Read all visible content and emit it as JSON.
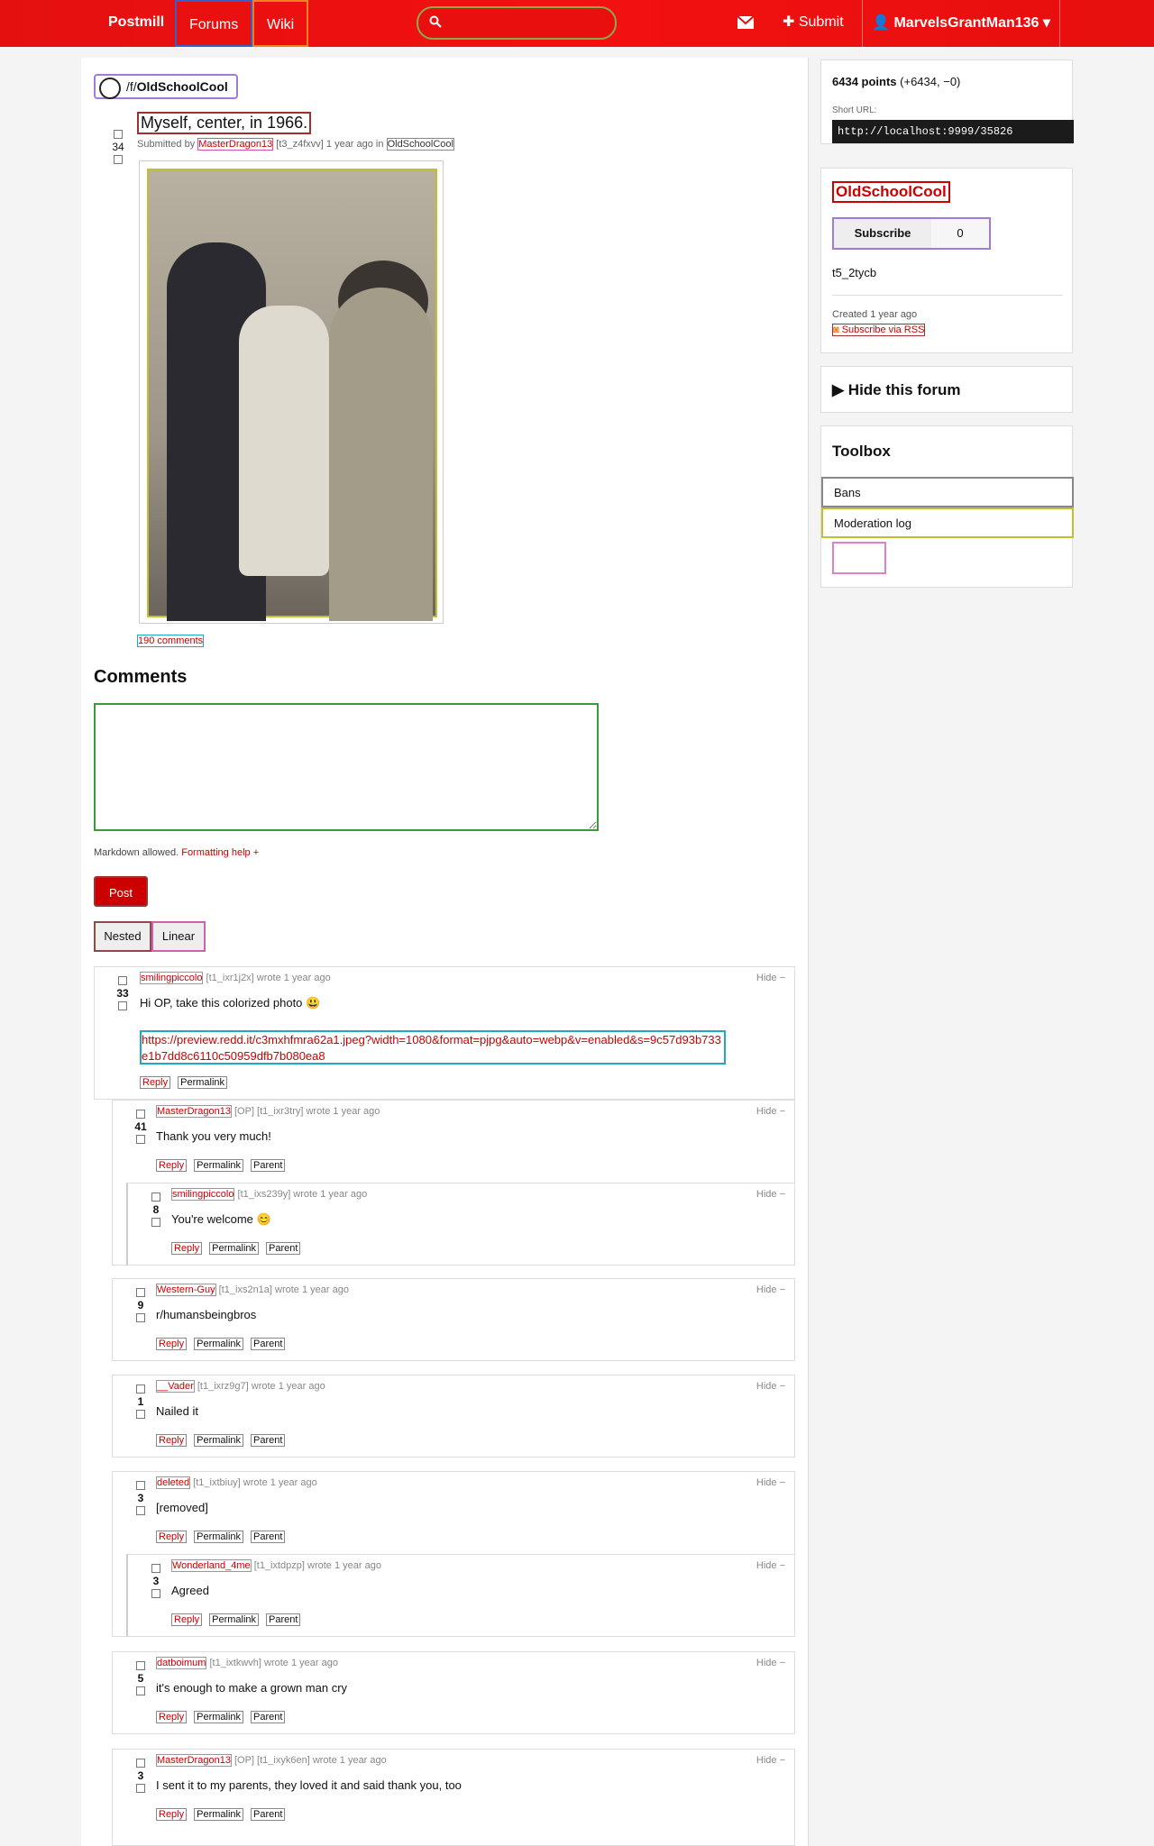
{
  "header": {
    "brand": "Postmill",
    "nav": {
      "forums": "Forums",
      "wiki": "Wiki"
    },
    "search_placeholder": "",
    "submit": "Submit",
    "user": "MarvelsGrantMan136 ▾"
  },
  "post": {
    "back_prefix": "/f/",
    "forum": "OldSchoolCool",
    "title": "Myself, center, in 1966.",
    "meta_prefix": "Submitted by",
    "author": "MasterDragon13",
    "meta_mid": "[t3_z4fxvv] 1 year ago in",
    "forum_link": "OldSchoolCool",
    "score": "34",
    "comments_link": "190 comments"
  },
  "comment_form": {
    "heading": "Comments",
    "markdown_note": "Markdown allowed.",
    "formatting_help": "Formatting help +",
    "post_label": "Post",
    "nested_label": "Nested",
    "linear_label": "Linear"
  },
  "comments": [
    {
      "user": "smilingpiccolo",
      "id": "[t1_ixr1j2x] wrote 1 year ago",
      "score": "33",
      "body": "Hi OP, take this colorized photo 😃",
      "link": "https://preview.redd.it/c3mxhfmra62a1.jpeg?width=1080&format=pjpg&auto=webp&v=enabled&s=9c57d93b733e1b7dd8c6110c50959dfb7b080ea8",
      "actions": [
        "Reply",
        "Permalink"
      ]
    },
    {
      "user": "MasterDragon13",
      "id": "[OP] [t1_ixr3try] wrote 1 year ago",
      "score": "41",
      "body": "Thank you very much!",
      "actions": [
        "Reply",
        "Permalink",
        "Parent"
      ]
    },
    {
      "user": "smilingpiccolo",
      "id": "[t1_ixs239y] wrote 1 year ago",
      "score": "8",
      "body": "You're welcome 😊",
      "actions": [
        "Reply",
        "Permalink",
        "Parent"
      ]
    },
    {
      "user": "Western-Guy",
      "id": "[t1_ixs2n1a] wrote 1 year ago",
      "score": "9",
      "body": "r/humansbeingbros",
      "actions": [
        "Reply",
        "Permalink",
        "Parent"
      ]
    },
    {
      "user": "__Vader",
      "id": "[t1_ixrz9g7] wrote 1 year ago",
      "score": "1",
      "body": "Nailed it",
      "actions": [
        "Reply",
        "Permalink",
        "Parent"
      ]
    },
    {
      "user": "deleted",
      "id": "[t1_ixtbiuy] wrote 1 year ago",
      "score": "3",
      "body": "[removed]",
      "actions": [
        "Reply",
        "Permalink",
        "Parent"
      ]
    },
    {
      "user": "Wonderland_4me",
      "id": "[t1_ixtdpzp] wrote 1 year ago",
      "score": "3",
      "body": "Agreed",
      "actions": [
        "Reply",
        "Permalink",
        "Parent"
      ]
    },
    {
      "user": "datboimum",
      "id": "[t1_ixtkwvh] wrote 1 year ago",
      "score": "5",
      "body": "it's enough to make a grown man cry",
      "actions": [
        "Reply",
        "Permalink",
        "Parent"
      ]
    },
    {
      "user": "MasterDragon13",
      "id": "[OP] [t1_ixyk6en] wrote 1 year ago",
      "score": "3",
      "body": "I sent it to my parents, they loved it and said thank you, too",
      "actions": [
        "Reply",
        "Permalink",
        "Parent"
      ]
    }
  ],
  "hide_label": "Hide −",
  "sidebar": {
    "points": "6434 points",
    "points_detail": "(+6434, −0)",
    "short_url_label": "Short URL:",
    "short_url": "http://localhost:9999/35826",
    "forum_name": "OldSchoolCool",
    "subscribe": "Subscribe",
    "subscribers": "0",
    "forum_id": "t5_2tycb",
    "created": "Created 1 year ago",
    "rss": "Subscribe via RSS",
    "hide_forum": "▶ Hide this forum",
    "toolbox_title": "Toolbox",
    "toolbox_items": [
      "Bans",
      "Moderation log"
    ]
  }
}
